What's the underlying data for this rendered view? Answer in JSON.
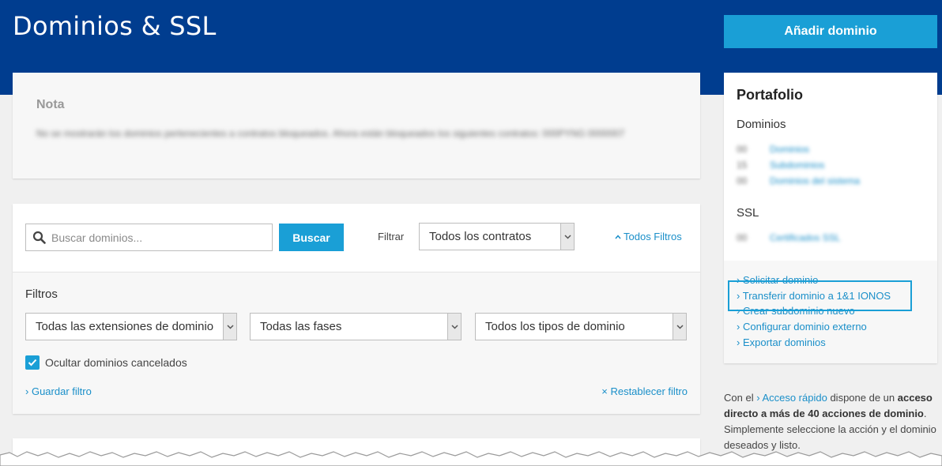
{
  "header": {
    "title": "Dominios & SSL",
    "add_domain_label": "Añadir dominio"
  },
  "nota": {
    "title": "Nota",
    "text": "No se mostrarán los dominios pertenecientes a contratos bloqueados. Ahora están bloqueados los siguientes contratos: 000PYNG 0000007"
  },
  "search": {
    "placeholder": "Buscar dominios...",
    "button_label": "Buscar",
    "filter_label": "Filtrar",
    "contracts_select": "Todos los contratos",
    "all_filters_label": "Todos Filtros"
  },
  "filters": {
    "title": "Filtros",
    "extensions_select": "Todas las extensiones de dominio",
    "phases_select": "Todas las fases",
    "types_select": "Todos los tipos de dominio",
    "hide_cancelled_label": "Ocultar dominios cancelados",
    "hide_cancelled_checked": true,
    "save_filter_label": "Guardar filtro",
    "reset_filter_label": "Restablecer filtro"
  },
  "portfolio": {
    "title": "Portafolio",
    "domains_title": "Dominios",
    "domain_rows": [
      {
        "count": "00",
        "label": "Dominios"
      },
      {
        "count": "15",
        "label": "Subdominios"
      },
      {
        "count": "00",
        "label": "Dominios del sistema"
      }
    ],
    "ssl_title": "SSL",
    "ssl_rows": [
      {
        "count": "00",
        "label": "Certificados SSL"
      }
    ],
    "links": [
      "Solicitar dominio",
      "Transferir dominio a 1&1 IONOS",
      "Crear subdominio nuevo",
      "Configurar dominio externo",
      "Exportar dominios"
    ]
  },
  "info": {
    "prefix": "Con el",
    "link": "Acceso rápido",
    "mid": "dispone de un",
    "bold": "acceso directo a más de 40 acciones de dominio",
    "suffix": ". Simplemente seleccione la acción y el dominio deseados y listo."
  },
  "colors": {
    "header_bg": "#003d8f",
    "accent": "#1a9fd6",
    "link": "#1a8fc9"
  }
}
